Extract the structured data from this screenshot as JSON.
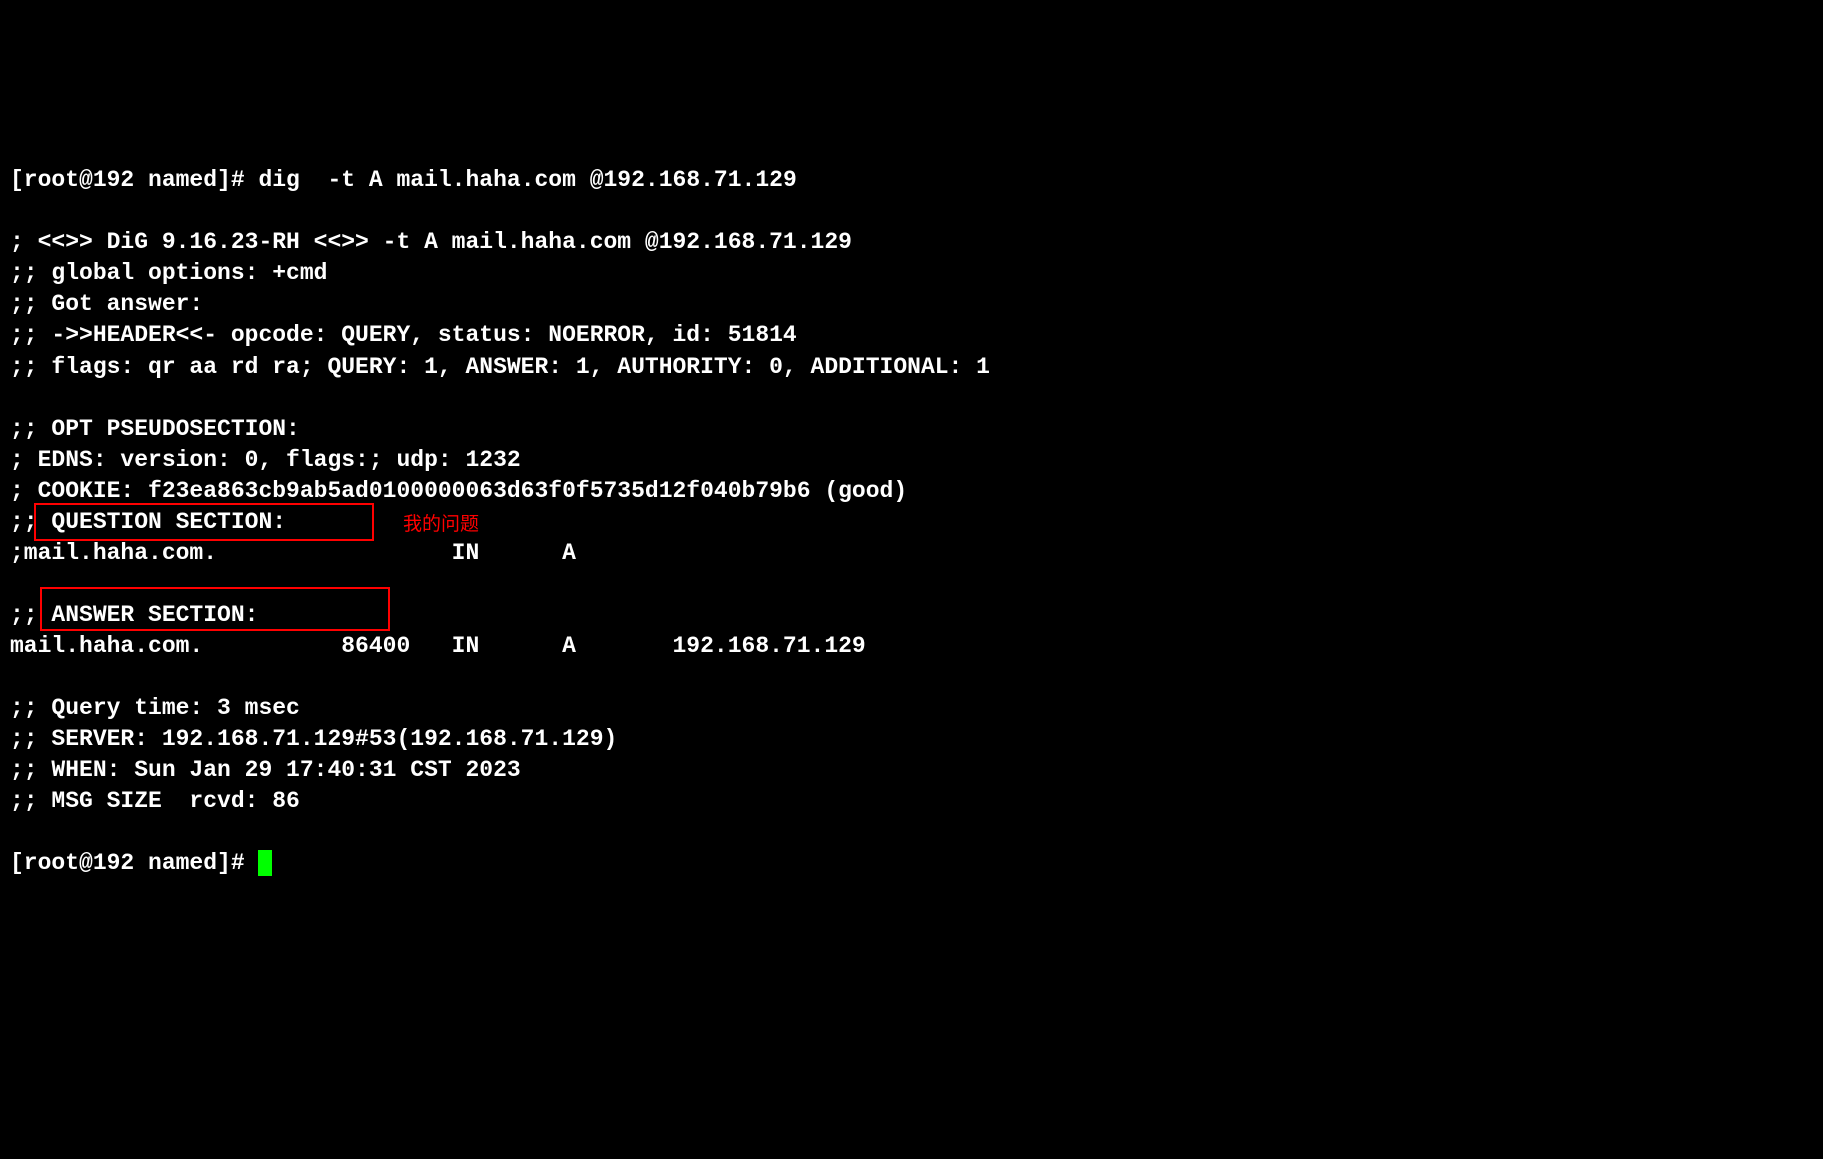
{
  "prompt": {
    "user": "root",
    "host": "192",
    "dir": "named",
    "symbol": "#"
  },
  "command": "dig  -t A mail.haha.com @192.168.71.129",
  "output": {
    "header_line": "; <<>> DiG 9.16.23-RH <<>> -t A mail.haha.com @192.168.71.129",
    "global_options": ";; global options: +cmd",
    "got_answer": ";; Got answer:",
    "header_info": ";; ->>HEADER<<- opcode: QUERY, status: NOERROR, id: 51814",
    "flags": ";; flags: qr aa rd ra; QUERY: 1, ANSWER: 1, AUTHORITY: 0, ADDITIONAL: 1",
    "opt_section": ";; OPT PSEUDOSECTION:",
    "edns": "; EDNS: version: 0, flags:; udp: 1232",
    "cookie": "; COOKIE: f23ea863cb9ab5ad0100000063d63f0f5735d12f040b79b6 (good)",
    "question_section_header": ";; QUESTION SECTION:",
    "question_record": ";mail.haha.com.                 IN      A",
    "answer_section_header": ";; ANSWER SECTION:",
    "answer_record": "mail.haha.com.          86400   IN      A       192.168.71.129",
    "query_time": ";; Query time: 3 msec",
    "server": ";; SERVER: 192.168.71.129#53(192.168.71.129)",
    "when": ";; WHEN: Sun Jan 29 17:40:31 CST 2023",
    "msg_size": ";; MSG SIZE  rcvd: 86"
  },
  "annotations": {
    "question_label": "我的问题"
  },
  "dig": {
    "version": "9.16.23-RH",
    "query_type": "A",
    "query_name": "mail.haha.com",
    "server_ip": "192.168.71.129",
    "opcode": "QUERY",
    "status": "NOERROR",
    "id": 51814,
    "flags_list": [
      "qr",
      "aa",
      "rd",
      "ra"
    ],
    "counts": {
      "query": 1,
      "answer": 1,
      "authority": 0,
      "additional": 1
    },
    "edns_version": 0,
    "udp": 1232,
    "cookie_value": "f23ea863cb9ab5ad0100000063d63f0f5735d12f040b79b6",
    "cookie_status": "good",
    "question": {
      "name": "mail.haha.com.",
      "class": "IN",
      "type": "A"
    },
    "answer": {
      "name": "mail.haha.com.",
      "ttl": 86400,
      "class": "IN",
      "type": "A",
      "data": "192.168.71.129"
    },
    "query_time_msec": 3,
    "server_full": "192.168.71.129#53(192.168.71.129)",
    "when_full": "Sun Jan 29 17:40:31 CST 2023",
    "msg_size_rcvd": 86
  },
  "prompt_line1": "[root@192 named]# ",
  "prompt_line2": "[root@192 named]# "
}
